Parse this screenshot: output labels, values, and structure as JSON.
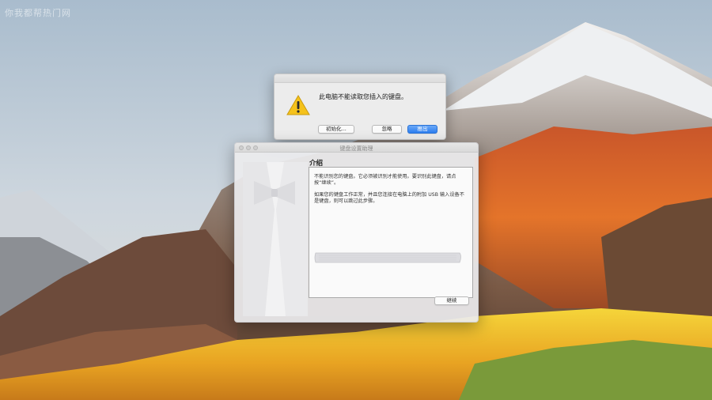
{
  "watermark": "你我都帮热门网",
  "alert": {
    "message": "此电脑不能读取您插入的键盘。",
    "buttons": {
      "initialize": "初始化...",
      "ignore": "忽略",
      "eject": "推出"
    }
  },
  "assistant": {
    "title": "键盘设置助理",
    "section_title": "介绍",
    "paragraph1": "不能识别您的键盘。它必须被识别才能使用。要识别此键盘，请点按“继续”。",
    "paragraph2": "如果您的键盘工作正常，并且您连接在电脑上的附加 USB 输入设备不是键盘，则可以跳过此步骤。",
    "continue_label": "继续"
  },
  "colors": {
    "accent": "#2d7ff0",
    "warning": "#f5c21b"
  }
}
